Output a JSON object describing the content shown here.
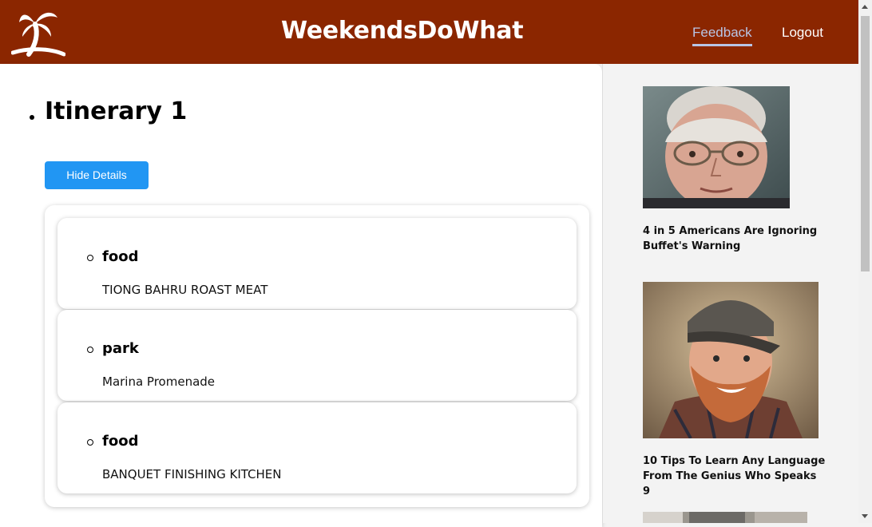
{
  "header": {
    "brand": "WeekendsDoWhat",
    "nav": {
      "feedback": "Feedback",
      "logout": "Logout"
    },
    "logo_icon": "palm-tree-icon",
    "bg_color": "#8b2600"
  },
  "itinerary": {
    "title": "Itinerary 1",
    "toggle_label": "Hide Details",
    "stops": [
      {
        "type": "food",
        "name": "TIONG BAHRU ROAST MEAT"
      },
      {
        "type": "park",
        "name": "Marina Promenade"
      },
      {
        "type": "food",
        "name": "BANQUET FINISHING KITCHEN"
      }
    ]
  },
  "sidebar": {
    "ads": [
      {
        "title": "4 in 5 Americans Are Ignoring Buffet's Warning",
        "image": "elderly-man-photo"
      },
      {
        "title": "10 Tips To Learn Any Language From The Genius Who Speaks 9",
        "image": "bearded-man-cap-photo"
      },
      {
        "title": "",
        "image": "partial-photo"
      }
    ]
  },
  "colors": {
    "accent": "#2196f3",
    "header": "#8b2600",
    "feedback_link": "#b8c5e6"
  }
}
